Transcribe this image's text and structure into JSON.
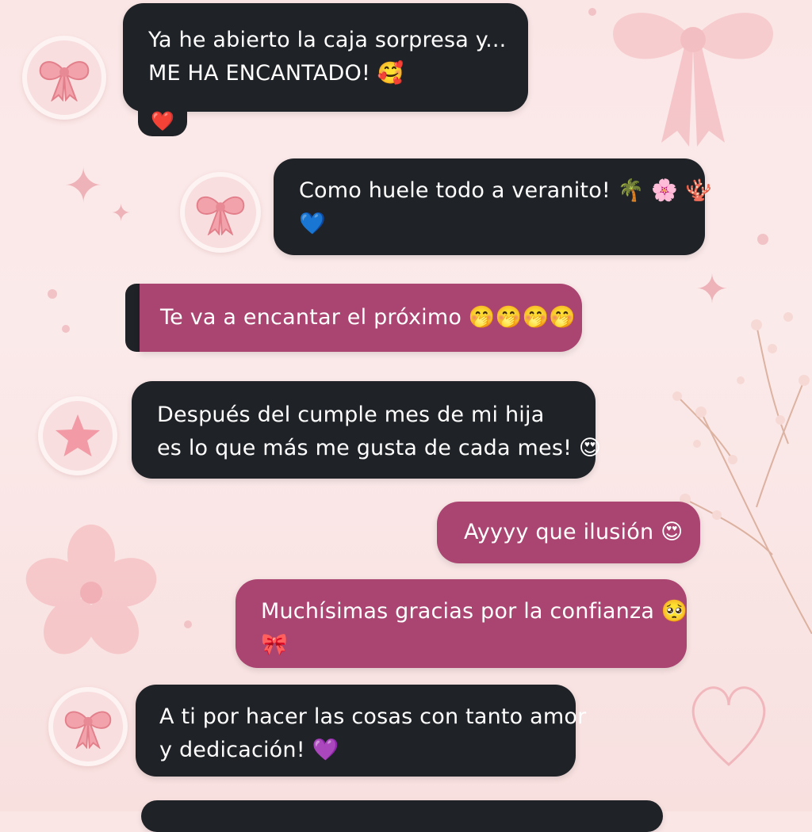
{
  "messages": [
    {
      "lines": [
        "Ya he abierto la caja sorpresa y...",
        "ME HA ENCANTADO! 🥰"
      ],
      "reaction": "❤️",
      "avatar": "bow-icon"
    },
    {
      "lines": [
        "Como huele todo a veranito! 🌴 🌸 🪸",
        "💙"
      ],
      "avatar": "bow-icon"
    },
    {
      "lines": [
        "Te va a encantar el próximo 🤭🤭🤭🤭"
      ]
    },
    {
      "lines": [
        "Después del cumple mes de mi hija",
        "es lo que más me gusta de cada mes! 😍"
      ],
      "avatar": "star-icon"
    },
    {
      "lines": [
        "Ayyyy que ilusión 😍"
      ]
    },
    {
      "lines": [
        "Muchísimas gracias por la confianza 🥺",
        "🎀"
      ]
    },
    {
      "lines": [
        "A ti por hacer las cosas con tanto amor",
        "y dedicación! 💜"
      ],
      "avatar": "bow-icon"
    }
  ],
  "colors": {
    "dark_bubble": "#1f2227",
    "pink_bubble": "#aa4470",
    "background": "#fbe6e6"
  }
}
